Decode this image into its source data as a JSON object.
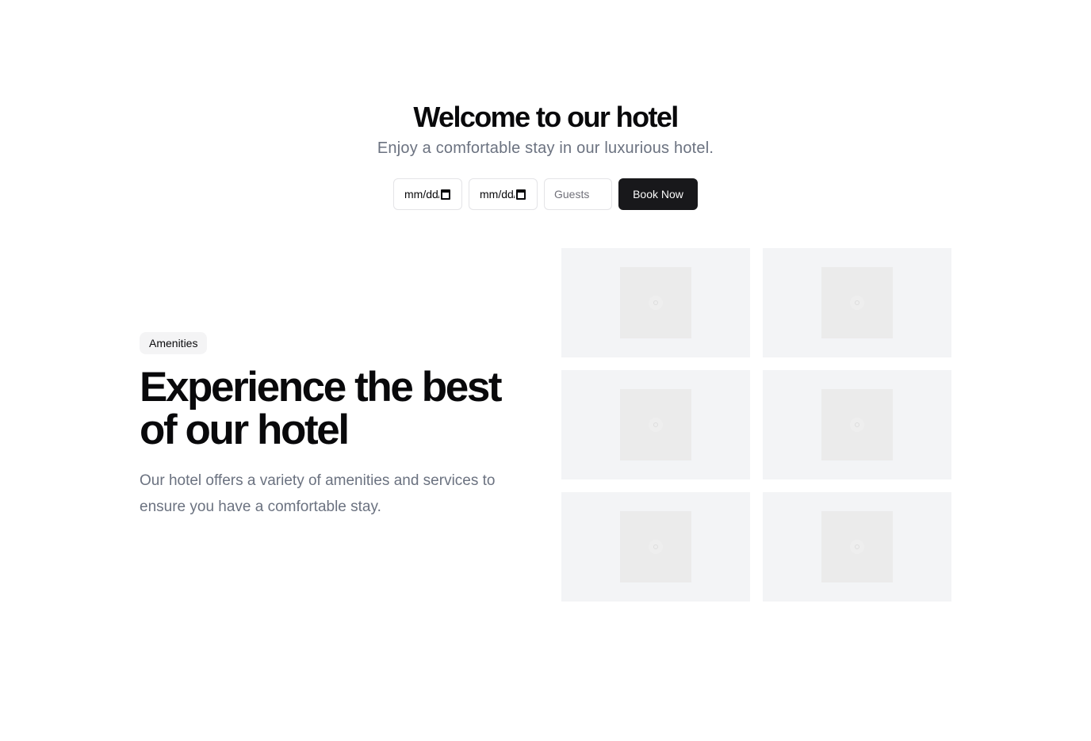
{
  "hero": {
    "title": "Welcome to our hotel",
    "subtitle": "Enjoy a comfortable stay in our luxurious hotel."
  },
  "booking": {
    "check_in_value": "mm/dd/yyyy",
    "check_out_value": "mm/dd/yyyy",
    "guests_placeholder": "Guests",
    "book_label": "Book Now"
  },
  "amenities": {
    "badge": "Amenities",
    "title": "Experience the best of our hotel",
    "description": "Our hotel offers a variety of amenities and services to ensure you have a comfortable stay."
  },
  "gallery": {
    "image_count": 6,
    "icon": "image-placeholder-icon"
  },
  "colors": {
    "primary_button": "#18181b",
    "muted_text": "#6b7280",
    "tile_background": "#f3f4f6",
    "badge_background": "#f4f4f5"
  }
}
